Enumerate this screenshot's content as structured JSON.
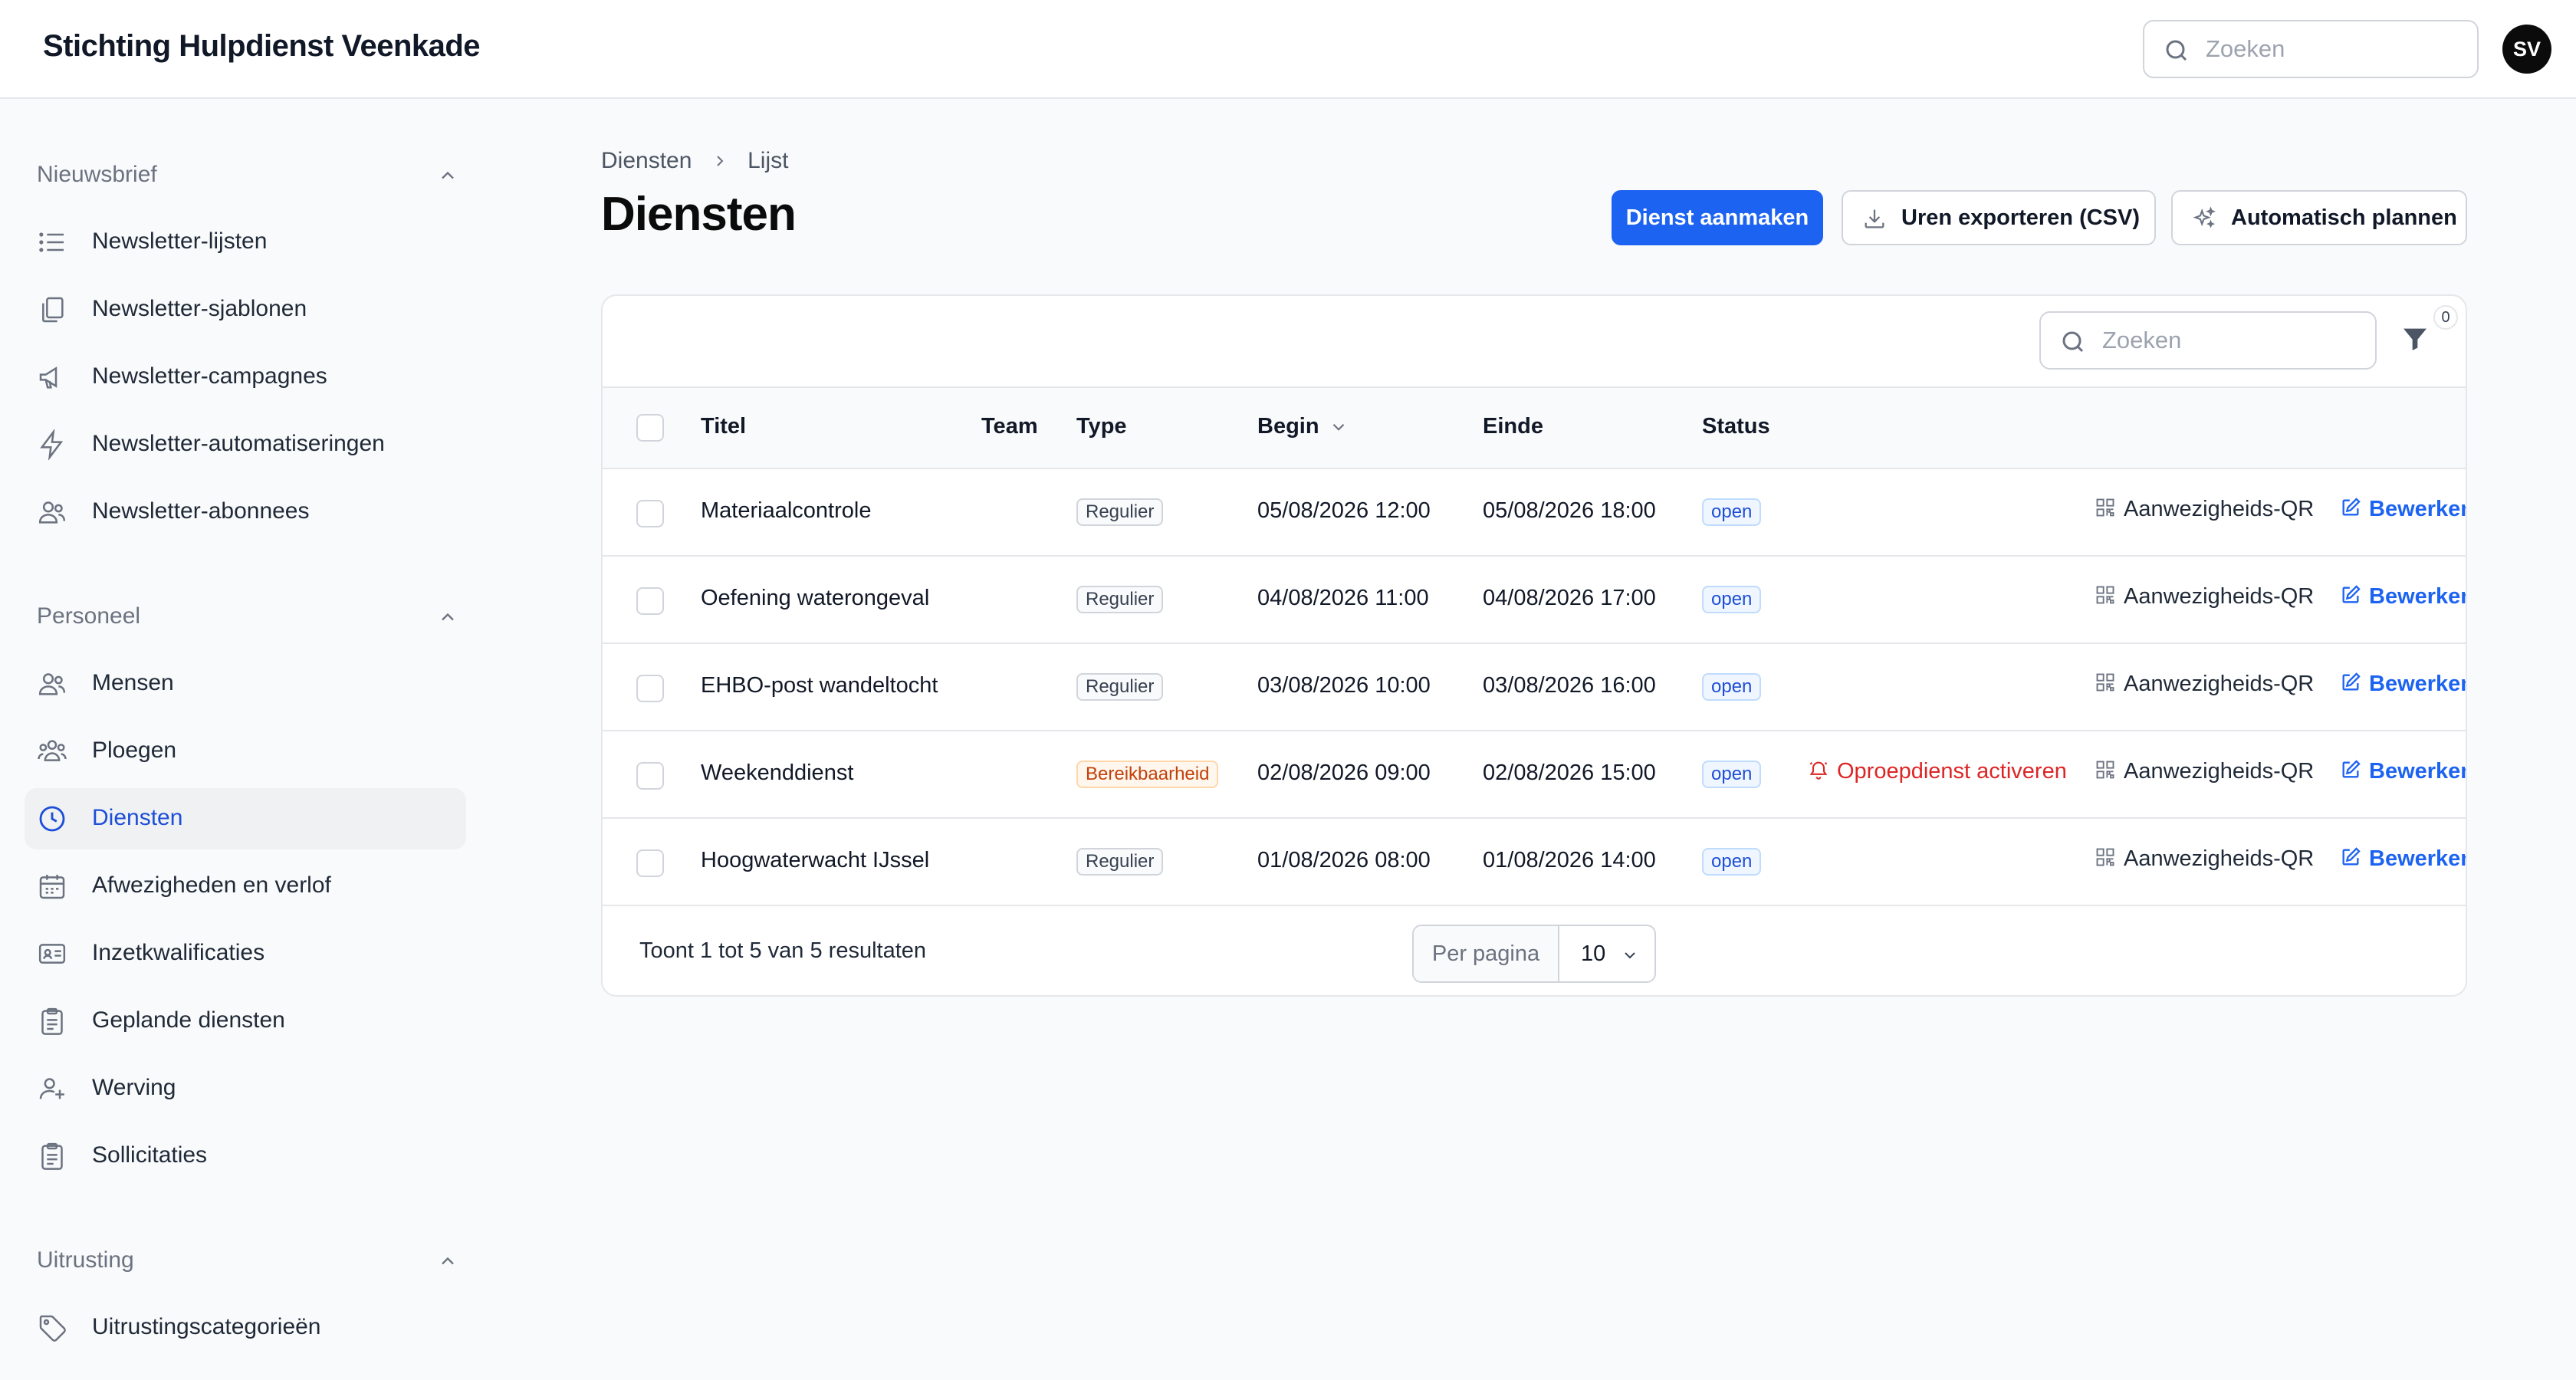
{
  "app": {
    "title": "Stichting Hulpdienst Veenkade",
    "user_initials": "SV"
  },
  "search": {
    "placeholder": "Zoeken"
  },
  "sidebar": {
    "groups": [
      {
        "title": "Nieuwsbrief",
        "items": [
          {
            "label": "Newsletter-lijsten",
            "icon": "list-icon"
          },
          {
            "label": "Newsletter-sjablonen",
            "icon": "documents-icon"
          },
          {
            "label": "Newsletter-campagnes",
            "icon": "megaphone-icon"
          },
          {
            "label": "Newsletter-automatiseringen",
            "icon": "lightning-icon"
          },
          {
            "label": "Newsletter-abonnees",
            "icon": "users-icon"
          }
        ]
      },
      {
        "title": "Personeel",
        "items": [
          {
            "label": "Mensen",
            "icon": "users-icon"
          },
          {
            "label": "Ploegen",
            "icon": "user-group-icon"
          },
          {
            "label": "Diensten",
            "icon": "clock-icon",
            "active": true
          },
          {
            "label": "Afwezigheden en verlof",
            "icon": "calendar-icon"
          },
          {
            "label": "Inzetkwalificaties",
            "icon": "id-card-icon"
          },
          {
            "label": "Geplande diensten",
            "icon": "clipboard-icon"
          },
          {
            "label": "Werving",
            "icon": "user-plus-icon"
          },
          {
            "label": "Sollicitaties",
            "icon": "clipboard-icon"
          }
        ]
      },
      {
        "title": "Uitrusting",
        "items": [
          {
            "label": "Uitrustingscategorieën",
            "icon": "tag-icon"
          }
        ]
      }
    ]
  },
  "breadcrumb": {
    "parent": "Diensten",
    "current": "Lijst"
  },
  "page": {
    "title": "Diensten"
  },
  "actions": {
    "create": "Dienst aanmaken",
    "export": "Uren exporteren (CSV)",
    "plan": "Automatisch plannen"
  },
  "table": {
    "search_placeholder": "Zoeken",
    "filter_count": "0",
    "columns": {
      "title": "Titel",
      "team": "Team",
      "type": "Type",
      "begin": "Begin",
      "end": "Einde",
      "status": "Status"
    },
    "rows": [
      {
        "title": "Materiaalcontrole",
        "team": "",
        "type": "Regulier",
        "begin": "05/08/2026 12:00",
        "end": "05/08/2026 18:00",
        "status": "open",
        "qr": "Aanwezigheids-QR",
        "edit": "Bewerken"
      },
      {
        "title": "Oefening waterongeval",
        "team": "",
        "type": "Regulier",
        "begin": "04/08/2026 11:00",
        "end": "04/08/2026 17:00",
        "status": "open",
        "qr": "Aanwezigheids-QR",
        "edit": "Bewerken"
      },
      {
        "title": "EHBO-post wandeltocht",
        "team": "",
        "type": "Regulier",
        "begin": "03/08/2026 10:00",
        "end": "03/08/2026 16:00",
        "status": "open",
        "qr": "Aanwezigheids-QR",
        "edit": "Bewerken"
      },
      {
        "title": "Weekenddienst",
        "team": "",
        "type": "Bereikbaarheid",
        "begin": "02/08/2026 09:00",
        "end": "02/08/2026 15:00",
        "status": "open",
        "oncall": "Oproepdienst activeren",
        "qr": "Aanwezigheids-QR",
        "edit": "Bewerken"
      },
      {
        "title": "Hoogwaterwacht IJssel",
        "team": "",
        "type": "Regulier",
        "begin": "01/08/2026 08:00",
        "end": "01/08/2026 14:00",
        "status": "open",
        "qr": "Aanwezigheids-QR",
        "edit": "Bewerken"
      }
    ],
    "footer": {
      "results": "Toont 1 tot 5 van 5 resultaten",
      "per_page_label": "Per pagina",
      "per_page_value": "10"
    }
  },
  "colors": {
    "primary": "#1d63f2",
    "danger": "#dc2626",
    "active_nav_bg": "#f0f1f3",
    "warning": "#c2410c"
  }
}
